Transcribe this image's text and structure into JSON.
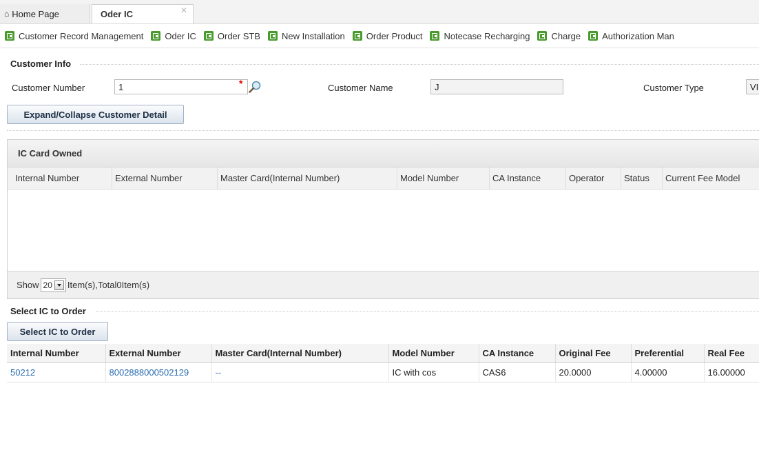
{
  "tabs": [
    {
      "label": "Home Page",
      "icon": "home-icon"
    },
    {
      "label": "Oder IC",
      "icon": "close-icon",
      "close": "✕"
    }
  ],
  "toolbar": {
    "items": [
      "Customer Record Management",
      "Oder IC",
      "Order STB",
      "New Installation",
      "Order Product",
      "Notecase Recharging",
      "Charge",
      "Authorization Man"
    ],
    "icon": "add-item-icon",
    "icon_color": "#4a9a2e"
  },
  "customer_info": {
    "legend": "Customer Info",
    "customer_number_label": "Customer Number",
    "customer_number_value": "1",
    "required_mark": "*",
    "customer_name_label": "Customer Name",
    "customer_name_value": "J",
    "customer_type_label": "Customer Type",
    "customer_type_value": "VI",
    "expand_button": "Expand/Collapse Customer Detail"
  },
  "ic_owned": {
    "title": "IC Card Owned",
    "columns": [
      "Internal Number",
      "External Number",
      "Master Card(Internal Number)",
      "Model Number",
      "CA Instance",
      "Operator",
      "Status",
      "Current Fee Model"
    ],
    "rows": [],
    "pager": {
      "show": "Show",
      "page_size": "20",
      "summary": "Item(s),Total0Item(s)"
    }
  },
  "select_ic": {
    "legend": "Select IC to Order",
    "button": "Select IC to Order",
    "columns": [
      "Internal Number",
      "External Number",
      "Master Card(Internal Number)",
      "Model Number",
      "CA Instance",
      "Original Fee",
      "Preferential",
      "Real Fee"
    ],
    "rows": [
      [
        "50212",
        "8002888000502129",
        "--",
        "IC with cos",
        "CAS6",
        "20.0000",
        "4.00000",
        "16.00000"
      ]
    ]
  },
  "colors": {
    "link": "#2a6db0",
    "required": "#e00000",
    "button_text": "#1e2f45"
  }
}
